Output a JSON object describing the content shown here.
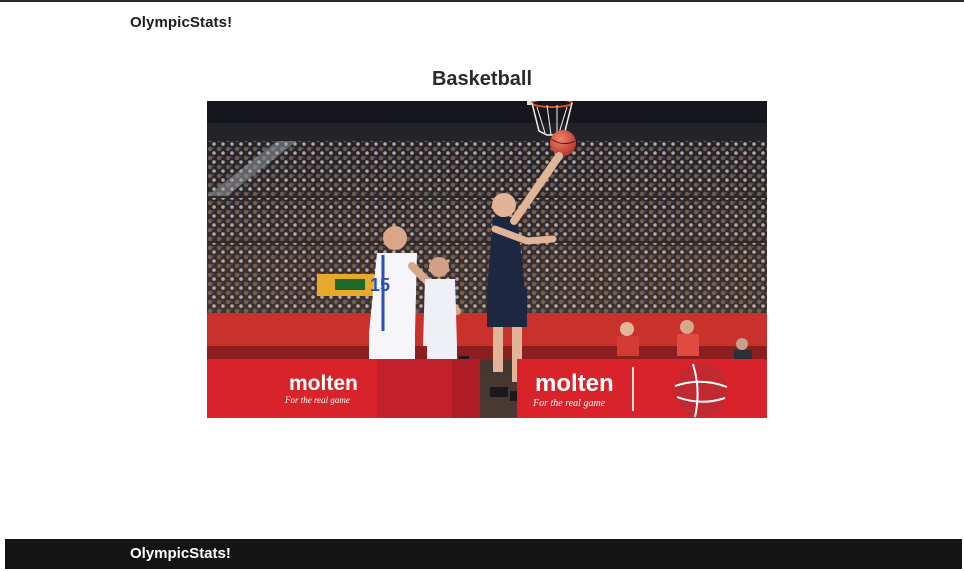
{
  "header": {
    "brand": "OlympicStats!"
  },
  "main": {
    "title": "Basketball",
    "image": {
      "alt": "Basketball game photo",
      "ad_brand": "molten",
      "ad_tagline": "For the real game",
      "jersey_number": "15"
    }
  },
  "footer": {
    "brand": "OlympicStats!"
  },
  "colors": {
    "footer_background": "#141414",
    "ad_board_red": "#d8232a"
  }
}
